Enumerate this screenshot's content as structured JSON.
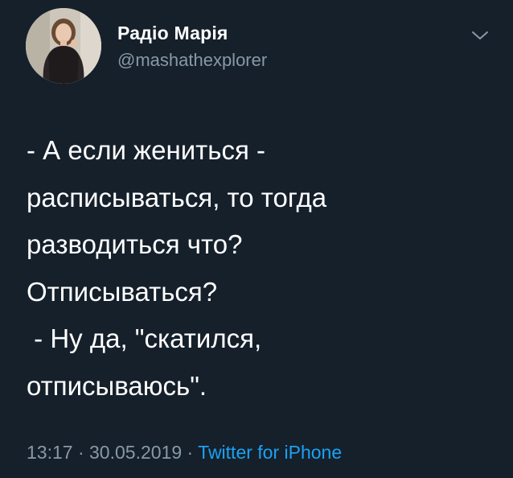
{
  "author": {
    "display_name": "Радіо Марія",
    "handle": "@mashathexplorer",
    "avatar_icon": "profile-photo"
  },
  "menu": {
    "icon": "chevron-down-icon"
  },
  "tweet": {
    "text": "- А если жениться -\nрасписываться, то тогда\nразводиться что?\nОтписываться?\n - Ну да, \"скатился,\nотписываюсь\"."
  },
  "meta": {
    "time": "13:17",
    "separator1": " · ",
    "date": "30.05.2019",
    "separator2": " · ",
    "source": "Twitter for iPhone"
  },
  "colors": {
    "background": "#15202b",
    "text": "#ffffff",
    "secondary_text": "#8899a6",
    "link": "#1da1f2"
  }
}
